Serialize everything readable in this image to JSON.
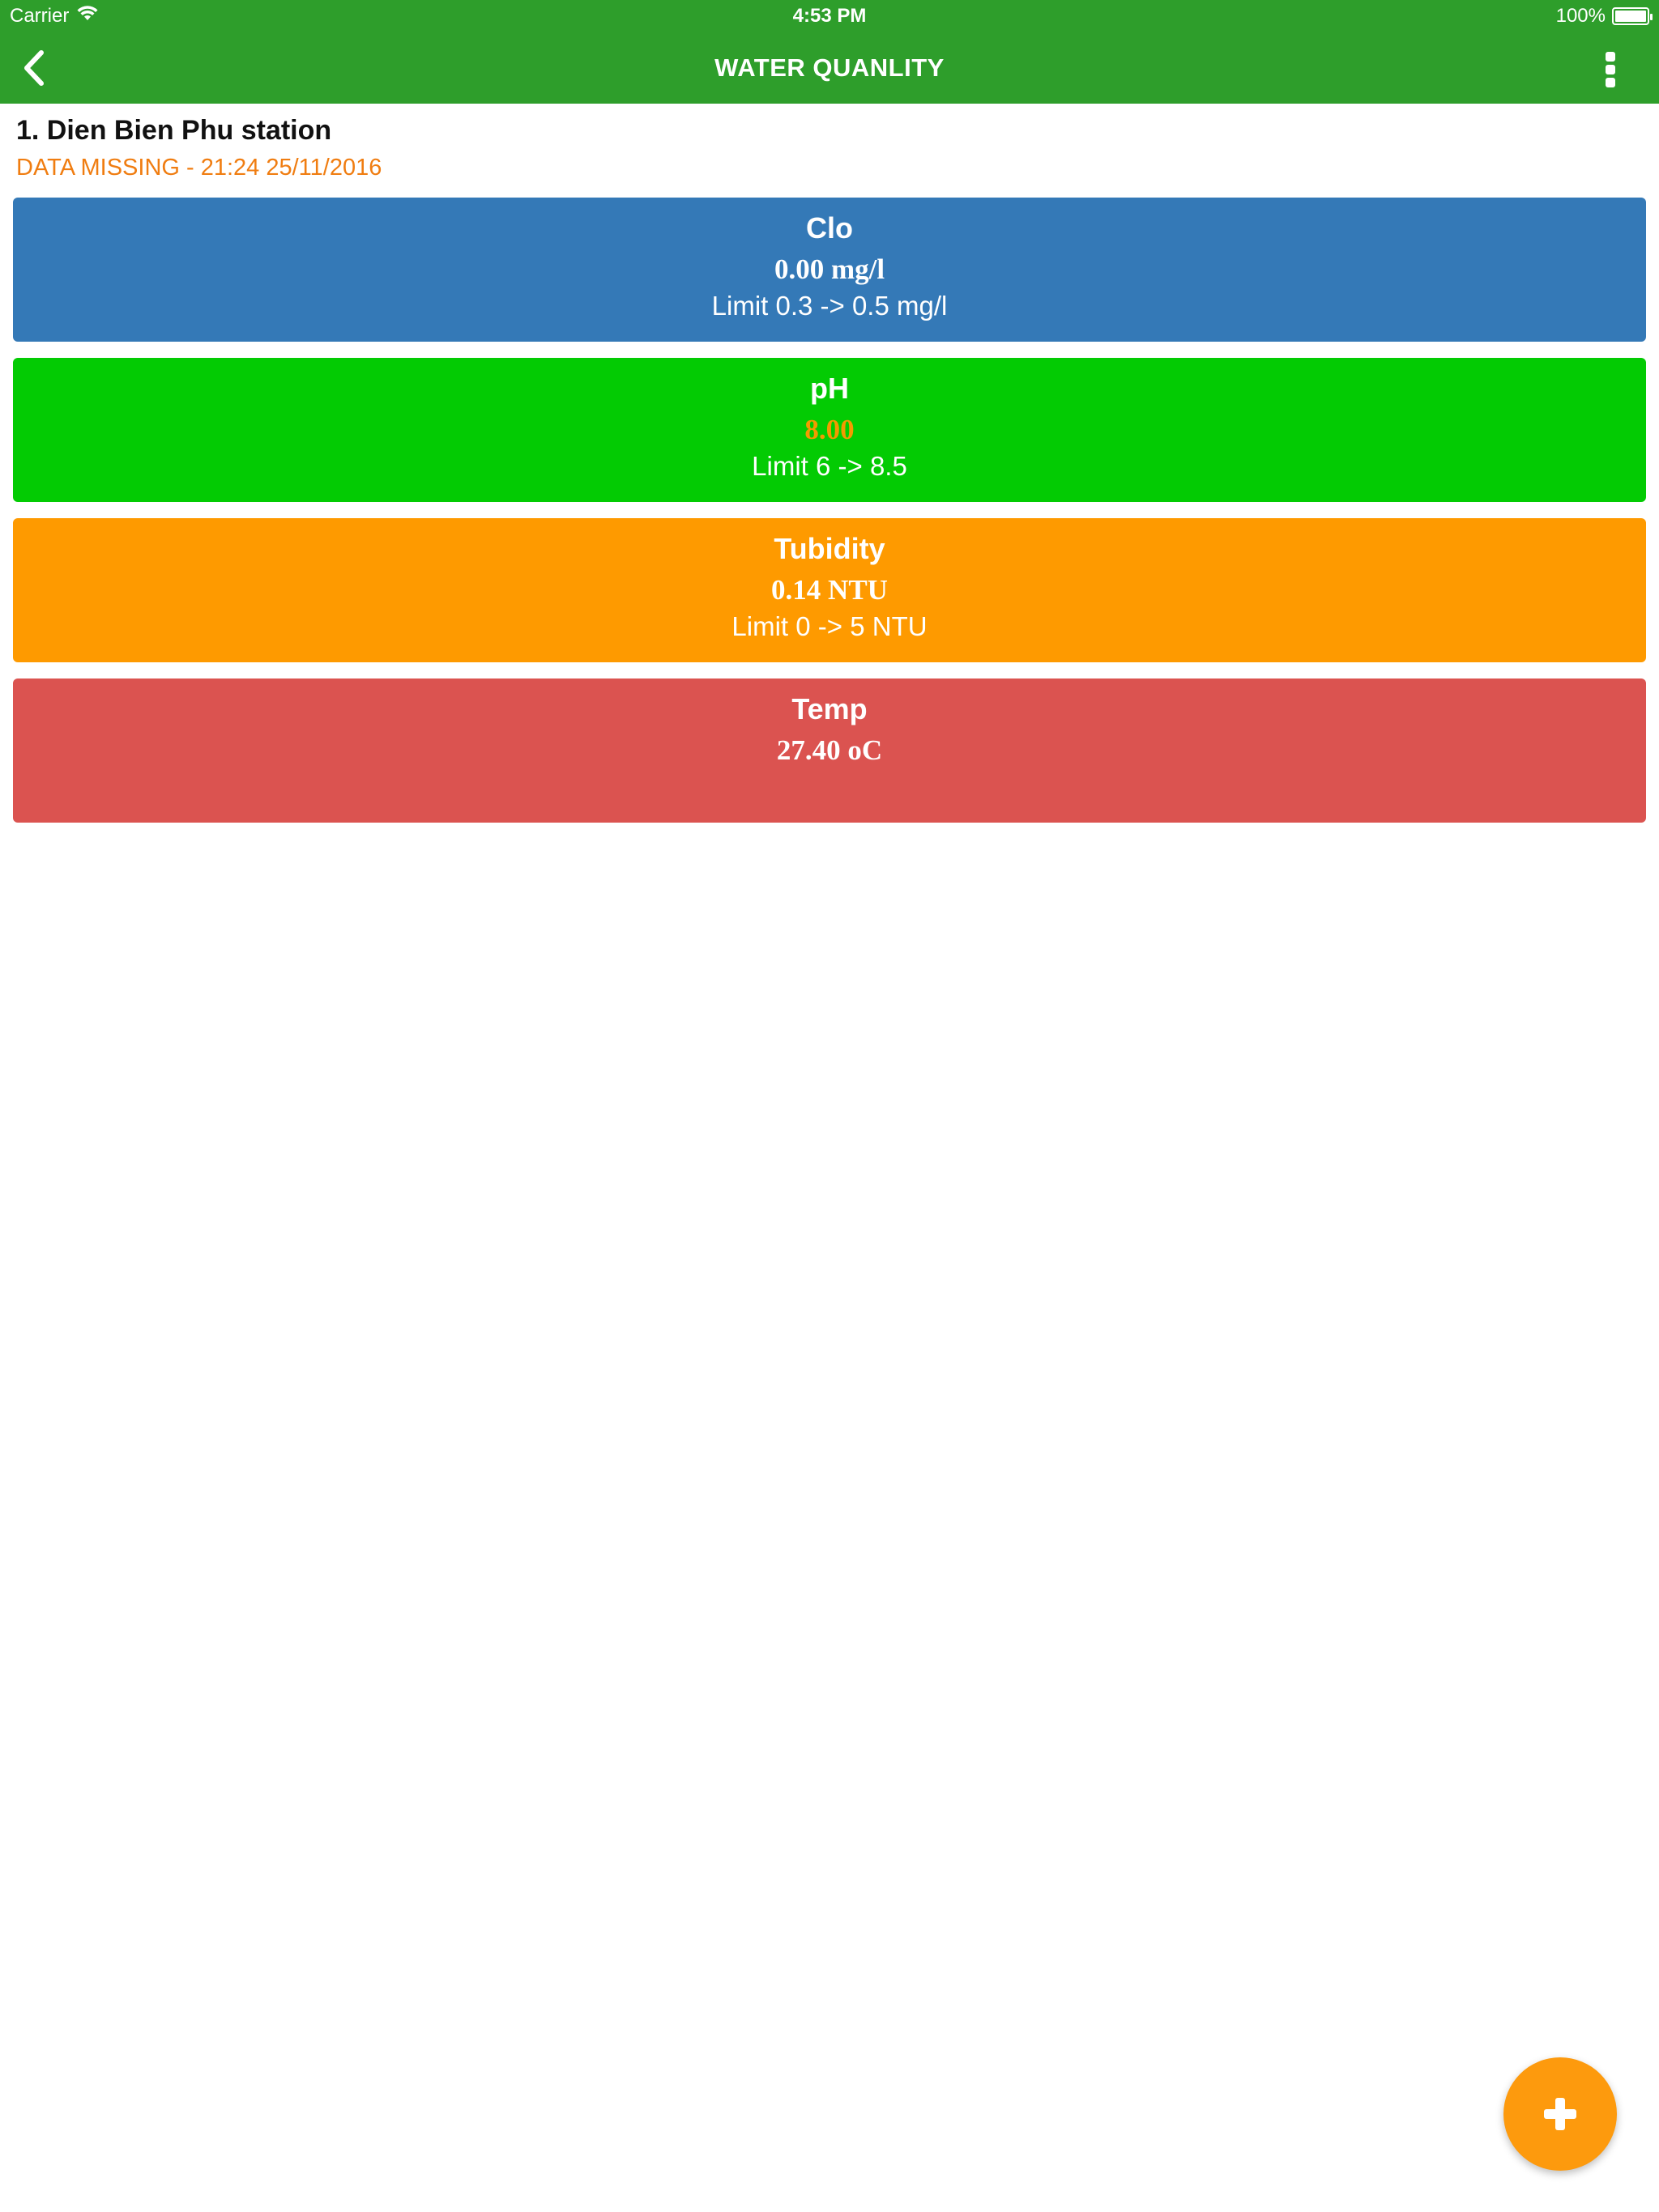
{
  "status_bar": {
    "carrier": "Carrier",
    "time": "4:53 PM",
    "battery": "100%"
  },
  "nav": {
    "title": "WATER QUANLITY",
    "back_icon": "chevron-left-icon",
    "more_icon": "more-vertical-icon",
    "color": "#2e9e2b"
  },
  "station": {
    "name": "1. Dien Bien Phu station",
    "status": "DATA MISSING - 21:24 25/11/2016",
    "status_color": "#f07d11"
  },
  "metrics": [
    {
      "title": "Clo",
      "value": "0.00 mg/l",
      "limit": "Limit 0.3 -> 0.5 mg/l",
      "bg_color": "#3479b7",
      "value_color": "#ffffff"
    },
    {
      "title": "pH",
      "value": "8.00",
      "limit": "Limit 6 -> 8.5",
      "bg_color": "#03cb03",
      "value_color": "#f39a00"
    },
    {
      "title": "Tubidity",
      "value": "0.14 NTU",
      "limit": "Limit 0 -> 5 NTU",
      "bg_color": "#fe9a00",
      "value_color": "#ffffff"
    },
    {
      "title": "Temp",
      "value": "27.40 oC",
      "limit": "",
      "bg_color": "#db5350",
      "value_color": "#ffffff"
    }
  ],
  "fab": {
    "icon": "plus-icon",
    "color": "#fd9a0d"
  }
}
